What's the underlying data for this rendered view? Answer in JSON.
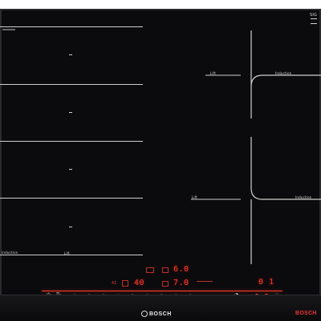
{
  "cooktop": {
    "brand": "BOSCH",
    "corner_label_top": "SIG",
    "corner_label_bottom": "",
    "left_zone_label": "Induction",
    "left_zone_mark": "Lift",
    "right_top_left_label": "Lift",
    "right_top_right_label": "Induction",
    "right_bottom_left_label": "Lift",
    "right_bottom_right_label": "Induction"
  },
  "controls": {
    "display_left_top": "6.0",
    "display_left_bottom": "7.0",
    "display_left_mid": "40",
    "display_left_small": "4I",
    "display_right": "0 1",
    "watermark": "BOSCH"
  },
  "colors": {
    "glass": "#0b0b0d",
    "lines": "#cfcfcf",
    "indicator": "#ff3a2a"
  }
}
